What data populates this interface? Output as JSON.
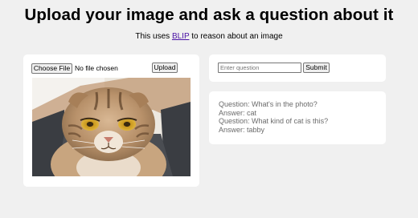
{
  "page": {
    "title": "Upload your image and ask a question about it",
    "subtitle_pre": "This uses ",
    "subtitle_link": "BLIP",
    "subtitle_post": " to reason about an image"
  },
  "upload": {
    "choose_file_label": "Choose File",
    "file_status": "No file chosen",
    "upload_label": "Upload"
  },
  "question": {
    "placeholder": "Enter question",
    "value": "",
    "submit_label": "Submit"
  },
  "history": [
    {
      "q_prefix": "Question: ",
      "q": "What's in the photo?",
      "a_prefix": "Answer: ",
      "a": "cat"
    },
    {
      "q_prefix": "Question: ",
      "q": "What kind of cat is this?",
      "a_prefix": "Answer: ",
      "a": "tabby"
    }
  ],
  "colors": {
    "background": "#f0f0f0",
    "card": "#ffffff",
    "link": "#4a12a5",
    "history_text": "#6b6b6b"
  }
}
